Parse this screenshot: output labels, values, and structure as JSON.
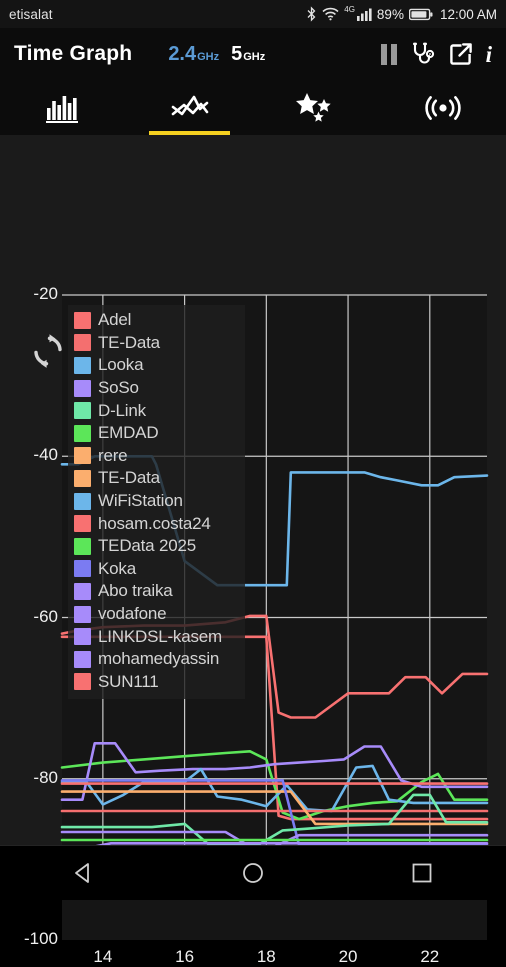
{
  "statusbar": {
    "carrier": "etisalat",
    "battery_percent": "89%",
    "clock": "12:00 AM",
    "network_type": "4G",
    "icons": [
      "bluetooth-icon",
      "wifi-icon",
      "cellular-signal-icon",
      "battery-icon"
    ]
  },
  "actionbar": {
    "title": "Time Graph",
    "bands": [
      {
        "num": "2.4",
        "unit": "GHz",
        "active": true
      },
      {
        "num": "5",
        "unit": "GHz",
        "active": false
      }
    ],
    "actions": [
      {
        "name": "pause-button",
        "label": "Pause"
      },
      {
        "name": "stethoscope-button",
        "label": "Channel Graph"
      },
      {
        "name": "share-button",
        "label": "Export"
      },
      {
        "name": "info-button",
        "label": "i"
      }
    ]
  },
  "tabs": [
    {
      "name": "tab-channel-graph",
      "icon": "bar-chart-icon",
      "active": false
    },
    {
      "name": "tab-time-graph",
      "icon": "time-graph-icon",
      "active": true
    },
    {
      "name": "tab-channel-rating",
      "icon": "stars-icon",
      "active": false
    },
    {
      "name": "tab-access-points",
      "icon": "radar-icon",
      "active": false
    }
  ],
  "refresh_icon": "refresh-icon",
  "legend": [
    {
      "label": "Adel",
      "color": "#f87171"
    },
    {
      "label": "TE-Data",
      "color": "#f46f6f"
    },
    {
      "label": "Looka",
      "color": "#6cb6ea"
    },
    {
      "label": "SoSo",
      "color": "#a78bfa"
    },
    {
      "label": "D-Link",
      "color": "#6fe8a8"
    },
    {
      "label": "EMDAD",
      "color": "#5ce659"
    },
    {
      "label": "rere",
      "color": "#fbae6e"
    },
    {
      "label": "TE-Data",
      "color": "#fbae6e"
    },
    {
      "label": "WiFiStation",
      "color": "#6cb6ea"
    },
    {
      "label": "hosam.costa24",
      "color": "#f87171"
    },
    {
      "label": "TEData 2025",
      "color": "#5ce659"
    },
    {
      "label": "Koka",
      "color": "#7b7bf2"
    },
    {
      "label": "Abo traika",
      "color": "#a78bfa"
    },
    {
      "label": "vodafone",
      "color": "#a78bfa"
    },
    {
      "label": "LINKDSL-kasem",
      "color": "#a78bfa"
    },
    {
      "label": "mohamedyassin",
      "color": "#a78bfa"
    },
    {
      "label": "SUN111",
      "color": "#f87171"
    }
  ],
  "navbar": [
    {
      "name": "nav-back-button",
      "icon": "back-triangle-icon"
    },
    {
      "name": "nav-home-button",
      "icon": "home-circle-icon"
    },
    {
      "name": "nav-recents-button",
      "icon": "recents-square-icon"
    }
  ],
  "chart_data": {
    "type": "line",
    "title": "Time Graph",
    "xlabel": "",
    "ylabel": "",
    "xlim": [
      13.0,
      23.4
    ],
    "ylim": [
      -100,
      -20
    ],
    "xticks": [
      14,
      16,
      18,
      20,
      22
    ],
    "yticks": [
      -20,
      -40,
      -60,
      -80,
      -100
    ],
    "grid": true,
    "legend_position": "inside-top-left",
    "series": [
      {
        "name": "Looka",
        "color": "#6cb6ea",
        "x": [
          13.0,
          13.4,
          13.8,
          14.6,
          15.2,
          15.3,
          16.0,
          16.8,
          18.5,
          18.6,
          19.0,
          19.3,
          19.4,
          20.4,
          20.8,
          21.2,
          21.8,
          22.2,
          22.6,
          23.4
        ],
        "y": [
          -41.0,
          -41.0,
          -40.0,
          -40.0,
          -40.0,
          -41.0,
          -53.0,
          -56.0,
          -56.0,
          -42.0,
          -42.0,
          -42.0,
          -42.0,
          -42.0,
          -42.6,
          -43.0,
          -43.6,
          -43.6,
          -42.6,
          -42.4
        ]
      },
      {
        "name": "SUN111",
        "color": "#f87171",
        "x": [
          13.0,
          13.4,
          14.0,
          15.0,
          16.0,
          17.0,
          17.6,
          18.0,
          18.3,
          18.6,
          19.2,
          20.0,
          21.0,
          21.4,
          21.9,
          22.3,
          22.8,
          23.4
        ],
        "y": [
          -62.0,
          -61.6,
          -61.2,
          -61.0,
          -61.0,
          -60.6,
          -59.8,
          -59.8,
          -71.8,
          -72.4,
          -72.4,
          -69.4,
          -69.4,
          -67.4,
          -67.4,
          -69.4,
          -67.0,
          -67.0
        ]
      },
      {
        "name": "hosam.costa24",
        "color": "#f87171",
        "x": [
          13.0,
          14.0,
          15.0,
          16.0,
          17.0,
          18.0,
          18.3,
          18.6,
          19.0,
          20.0,
          21.0,
          22.0,
          23.4
        ],
        "y": [
          -62.4,
          -62.4,
          -62.4,
          -62.4,
          -62.4,
          -62.4,
          -84.6,
          -85.0,
          -85.0,
          -85.0,
          -85.0,
          -85.0,
          -85.0
        ]
      },
      {
        "name": "EMDAD",
        "color": "#5ce659",
        "x": [
          13.0,
          14.0,
          15.0,
          16.0,
          17.0,
          17.6,
          18.0,
          18.4,
          18.8,
          19.4,
          20.0,
          20.6,
          21.2,
          21.8,
          22.2,
          22.6,
          23.4
        ],
        "y": [
          -78.6,
          -78.0,
          -77.6,
          -77.2,
          -76.8,
          -76.6,
          -77.6,
          -84.2,
          -85.0,
          -84.0,
          -83.4,
          -83.0,
          -82.8,
          -80.4,
          -79.4,
          -82.6,
          -82.6
        ]
      },
      {
        "name": "Abo traika",
        "color": "#a78bfa",
        "x": [
          13.0,
          13.5,
          13.8,
          14.3,
          14.8,
          15.4,
          16.2,
          17.0,
          17.6,
          18.2,
          18.8,
          19.4,
          19.9,
          20.4,
          20.8,
          21.3,
          21.8,
          22.4,
          23.4
        ],
        "y": [
          -82.6,
          -82.6,
          -75.6,
          -75.6,
          -79.2,
          -79.0,
          -78.8,
          -78.8,
          -78.6,
          -78.2,
          -78.0,
          -77.8,
          -77.6,
          -76.0,
          -76.0,
          -80.2,
          -81.0,
          -81.0,
          -81.0
        ]
      },
      {
        "name": "WiFiStation",
        "color": "#6cb6ea",
        "x": [
          13.0,
          13.6,
          14.0,
          14.5,
          15.0,
          16.0,
          16.4,
          16.8,
          17.4,
          18.0,
          18.5,
          19.0,
          19.6,
          20.2,
          20.6,
          21.0,
          21.6,
          22.2,
          23.4
        ],
        "y": [
          -80.4,
          -80.4,
          -83.2,
          -82.0,
          -80.4,
          -80.4,
          -78.8,
          -82.2,
          -82.6,
          -83.4,
          -80.8,
          -83.8,
          -84.0,
          -78.6,
          -78.4,
          -82.6,
          -83.0,
          -83.0,
          -83.0
        ]
      },
      {
        "name": "Adel",
        "color": "#f87171",
        "x": [
          13.0,
          14.0,
          15.0,
          16.0,
          17.0,
          18.0,
          19.0,
          20.0,
          21.0,
          22.0,
          23.4
        ],
        "y": [
          -80.6,
          -80.6,
          -80.6,
          -80.6,
          -80.6,
          -80.6,
          -80.6,
          -80.6,
          -80.6,
          -80.6,
          -80.6
        ]
      },
      {
        "name": "TE-Data",
        "color": "#f46f6f",
        "x": [
          13.0,
          14.0,
          15.0,
          16.0,
          17.0,
          18.0,
          19.0,
          20.0,
          21.0,
          22.0,
          23.4
        ],
        "y": [
          -84.0,
          -84.0,
          -84.0,
          -84.0,
          -84.0,
          -84.0,
          -84.0,
          -84.0,
          -84.0,
          -84.0,
          -84.0
        ]
      },
      {
        "name": "rere",
        "color": "#fbae6e",
        "x": [
          13.0,
          14.0,
          15.0,
          16.0,
          17.0,
          18.0,
          18.6,
          19.2,
          20.0,
          21.0,
          22.0,
          23.4
        ],
        "y": [
          -81.6,
          -81.6,
          -81.6,
          -81.6,
          -81.6,
          -81.6,
          -81.6,
          -85.6,
          -85.6,
          -85.6,
          -85.6,
          -85.6
        ]
      },
      {
        "name": "TE-Data-2",
        "color": "#fbae6e",
        "x": [
          13.0,
          13.6,
          14.2,
          15.0,
          16.0,
          17.0,
          18.0,
          19.0,
          20.0,
          21.0,
          22.0,
          23.4
        ],
        "y": [
          -92.2,
          -92.2,
          -90.2,
          -90.2,
          -90.2,
          -90.2,
          -90.2,
          -90.2,
          -90.2,
          -90.2,
          -90.2,
          -90.2
        ]
      },
      {
        "name": "Koka",
        "color": "#7b7bf2",
        "x": [
          13.0,
          14.0,
          15.0,
          16.0,
          17.0,
          18.0,
          18.4,
          18.8,
          19.4,
          20.0,
          21.0,
          22.0,
          23.4
        ],
        "y": [
          -80.2,
          -80.2,
          -80.2,
          -80.2,
          -80.2,
          -80.2,
          -80.2,
          -88.2,
          -88.2,
          -88.2,
          -88.2,
          -88.2,
          -88.2
        ]
      },
      {
        "name": "D-Link",
        "color": "#6fe8a8",
        "x": [
          13.0,
          14.0,
          14.6,
          15.2,
          16.0,
          16.6,
          17.2,
          17.8,
          18.4,
          19.0,
          20.0,
          21.0,
          21.6,
          22.0,
          22.4,
          23.4
        ],
        "y": [
          -86.0,
          -86.0,
          -86.0,
          -86.0,
          -85.6,
          -88.2,
          -88.2,
          -88.2,
          -86.4,
          -86.2,
          -85.8,
          -85.6,
          -82.0,
          -82.0,
          -85.4,
          -85.4
        ]
      },
      {
        "name": "SoSo",
        "color": "#a78bfa",
        "x": [
          13.0,
          14.0,
          15.0,
          16.0,
          17.0,
          17.6,
          18.2,
          18.8,
          19.4,
          20.0,
          21.0,
          22.0,
          23.4
        ],
        "y": [
          -86.6,
          -86.6,
          -86.6,
          -86.6,
          -86.6,
          -88.4,
          -88.4,
          -87.0,
          -87.0,
          -87.0,
          -87.0,
          -87.0,
          -87.0
        ]
      },
      {
        "name": "vodafone",
        "color": "#a78bfa",
        "x": [
          13.0,
          13.6,
          14.2,
          15.0,
          16.0,
          17.0,
          18.0,
          19.0,
          20.0,
          21.0,
          22.0,
          23.4
        ],
        "y": [
          -88.6,
          -88.6,
          -88.0,
          -88.0,
          -88.0,
          -88.0,
          -88.0,
          -88.0,
          -88.0,
          -88.0,
          -88.0,
          -88.0
        ]
      },
      {
        "name": "LINKDSL-kasem",
        "color": "#a78bfa",
        "x": [
          13.0,
          14.0,
          15.0,
          16.0,
          17.0,
          18.0,
          18.6,
          19.2,
          20.0,
          21.0,
          22.0,
          22.6,
          23.4
        ],
        "y": [
          -90.6,
          -90.6,
          -90.6,
          -90.6,
          -90.6,
          -90.6,
          -92.6,
          -92.6,
          -92.6,
          -92.6,
          -92.6,
          -90.2,
          -90.2
        ]
      },
      {
        "name": "mohamedyassin",
        "color": "#a78bfa",
        "x": [
          13.0,
          14.0,
          15.0,
          16.0,
          17.0,
          18.0,
          19.0,
          20.0,
          21.0,
          22.0,
          23.4
        ],
        "y": [
          -89.4,
          -89.4,
          -89.4,
          -89.4,
          -89.4,
          -89.4,
          -89.4,
          -89.4,
          -89.4,
          -89.4,
          -89.4
        ]
      },
      {
        "name": "TEData 2025",
        "color": "#5ce659",
        "x": [
          13.0,
          14.0,
          15.0,
          15.6,
          16.2,
          17.0,
          18.0,
          19.0,
          20.0,
          21.0,
          22.0,
          23.4
        ],
        "y": [
          -87.6,
          -87.6,
          -87.6,
          -87.6,
          -87.6,
          -87.6,
          -87.6,
          -87.6,
          -87.6,
          -87.6,
          -87.6,
          -87.6
        ]
      }
    ]
  }
}
